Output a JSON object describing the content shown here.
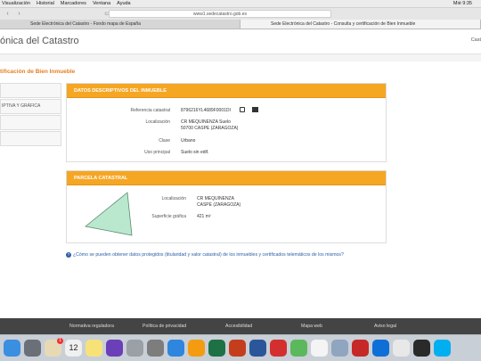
{
  "menubar": {
    "items": [
      "Visualización",
      "Historial",
      "Marcadores",
      "Ventana",
      "Ayuda"
    ],
    "clock": "Mié 9:35"
  },
  "browser": {
    "url": "www1.sedecatastro.gob.es",
    "tabs": [
      "Sede Electrónica del Catastro - Fondo mapa de España",
      "Sede Electrónica del Catastro - Consulta y certificación de Bien Inmueble"
    ]
  },
  "site": {
    "title": "ónica del Catastro",
    "right_text": "Cast",
    "page_heading": "tificación de Bien Inmueble"
  },
  "leftnav": {
    "items": [
      "",
      "IPTIVA Y GRÁFICA",
      "",
      ""
    ]
  },
  "panel1": {
    "title": "DATOS DESCRIPTIVOS DEL INMUEBLE",
    "ref_label": "Referencia catastral",
    "ref_value": "8796216YL4689F0001DI",
    "loc_label": "Localización",
    "loc_line1": "CR MEQUINENZA Suelo",
    "loc_line2": "50700 CASPE (ZARAGOZA)",
    "clase_label": "Clase",
    "clase_value": "Urbano",
    "uso_label": "Uso principal",
    "uso_value": "Suelo sin edif."
  },
  "panel2": {
    "title": "PARCELA CATASTRAL",
    "loc_label": "Localización",
    "loc_line1": "CR MEQUINENZA",
    "loc_line2": "CASPE (ZARAGOZA)",
    "sup_label": "Superficie gráfica",
    "sup_value": "421 m²"
  },
  "help_link": "¿Cómo se pueden obtener datos protegidos (titularidad y valor catastral) de los inmuebles y certificados telemáticos de los mismos?",
  "footer": {
    "links": [
      "Normativa reguladora",
      "Política de privacidad",
      "Accesibilidad",
      "Mapa web",
      "Aviso legal"
    ]
  },
  "dock": {
    "calendar_day": "12",
    "badge": "1",
    "apps": [
      "finder",
      "launchpad",
      "contacts",
      "calendar",
      "notes",
      "stars",
      "safari-blocked",
      "system-preferences",
      "safari",
      "photos",
      "excel",
      "powerpoint",
      "word",
      "acrobat",
      "maps",
      "music",
      "preview",
      "acrobat-reader",
      "teamviewer",
      "chrome",
      "quicktime",
      "skype"
    ]
  }
}
